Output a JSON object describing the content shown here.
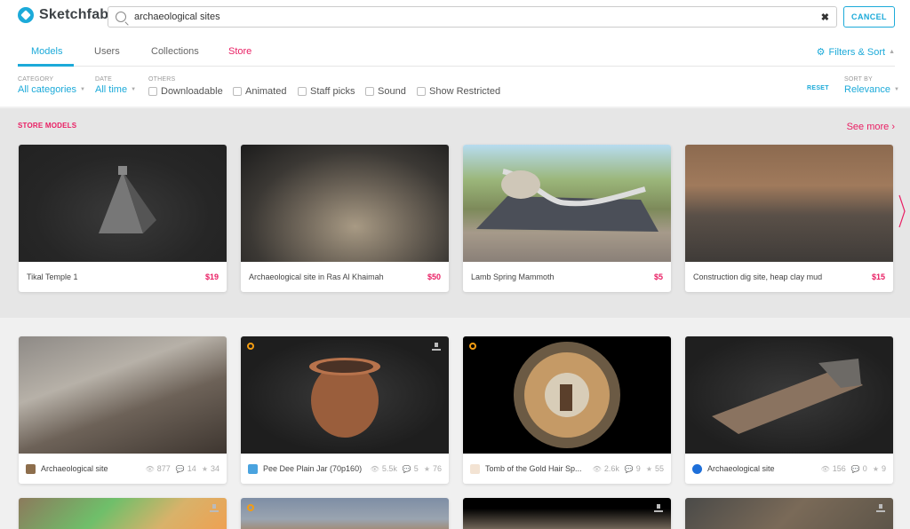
{
  "brand": {
    "name": "Sketchfab",
    "accent": "#1caad9",
    "store_color": "#e91e63"
  },
  "search": {
    "value": "archaeological sites",
    "placeholder": "Search",
    "clear_label": "✖",
    "cancel_label": "CANCEL"
  },
  "tabs": [
    {
      "label": "Models",
      "active": true
    },
    {
      "label": "Users",
      "active": false
    },
    {
      "label": "Collections",
      "active": false
    },
    {
      "label": "Store",
      "active": false
    }
  ],
  "filters_sort": {
    "label": "Filters & Sort",
    "icon": "sliders-icon"
  },
  "filters": {
    "category": {
      "label": "CATEGORY",
      "value": "All categories"
    },
    "date": {
      "label": "DATE",
      "value": "All time"
    },
    "others_label": "OTHERS",
    "checkboxes": [
      {
        "label": "Downloadable",
        "checked": false
      },
      {
        "label": "Animated",
        "checked": false
      },
      {
        "label": "Staff picks",
        "checked": false
      },
      {
        "label": "Sound",
        "checked": false
      },
      {
        "label": "Show Restricted",
        "checked": false
      }
    ],
    "reset_label": "RESET",
    "sort": {
      "label": "SORT BY",
      "value": "Relevance"
    }
  },
  "store": {
    "title": "STORE MODELS",
    "see_more": "See more ›",
    "items": [
      {
        "title": "Tikal Temple 1",
        "price": "$19"
      },
      {
        "title": "Archaeological site in Ras Al Khaimah",
        "price": "$50"
      },
      {
        "title": "Lamb Spring Mammoth",
        "price": "$5"
      },
      {
        "title": "Construction dig site, heap clay mud",
        "price": "$15"
      }
    ]
  },
  "results": [
    {
      "title": "Archaeological site",
      "views": "877",
      "comments": "14",
      "likes": "34",
      "badge": false,
      "downloadable": false,
      "avatar_color": "#8d6e4c"
    },
    {
      "title": "Pee Dee Plain Jar (70p160)",
      "views": "5.5k",
      "comments": "5",
      "likes": "76",
      "badge": true,
      "downloadable": true,
      "avatar_color": "#4aa3df"
    },
    {
      "title": "Tomb of the Gold Hair Sp...",
      "views": "2.6k",
      "comments": "9",
      "likes": "55",
      "badge": true,
      "downloadable": false,
      "avatar_color": "#f3e3d3"
    },
    {
      "title": "Archaeological site",
      "views": "156",
      "comments": "0",
      "likes": "9",
      "badge": false,
      "downloadable": false,
      "avatar_color": "#1e6fd9"
    }
  ],
  "results_row2": [
    {
      "badge": false,
      "downloadable": true
    },
    {
      "badge": true,
      "downloadable": false
    },
    {
      "badge": false,
      "downloadable": true
    },
    {
      "badge": false,
      "downloadable": true
    }
  ]
}
